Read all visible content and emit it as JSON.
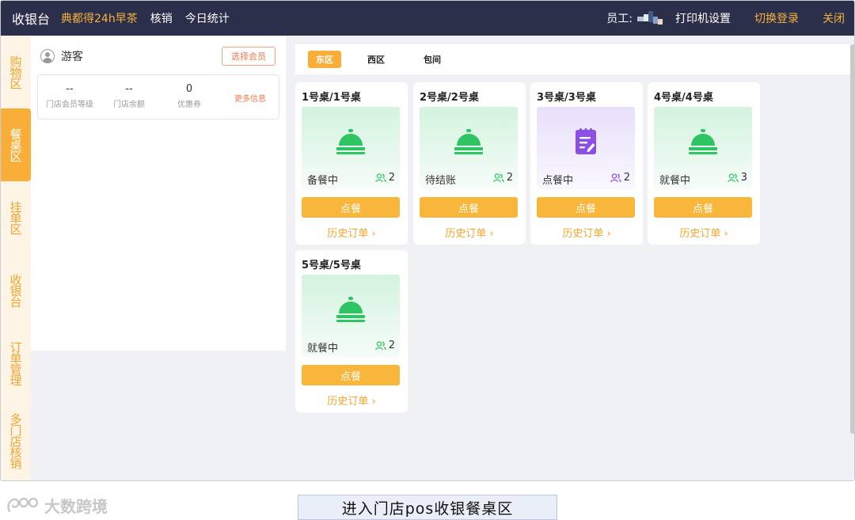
{
  "topbar": {
    "brand": "收银台",
    "store_name": "典都得24h早茶",
    "nav": [
      "核销",
      "今日统计"
    ],
    "staff_label": "员工:",
    "printer_settings": "打印机设置",
    "switch_login": "切换登录",
    "close": "关闭",
    "accent_color": "#f7b23b",
    "background_color": "#2b2f4a"
  },
  "sidebar": {
    "items": [
      {
        "label": "购物区",
        "active": false
      },
      {
        "label": "餐桌区",
        "active": true
      },
      {
        "label": "挂单区",
        "active": false
      },
      {
        "label": "收银台",
        "active": false
      },
      {
        "label": "订单管理",
        "active": false
      },
      {
        "label": "多门店核销",
        "active": false
      }
    ]
  },
  "member": {
    "guest_label": "游客",
    "choose_member": "选择会员",
    "stats": [
      {
        "value": "--",
        "label": "门店会员等级"
      },
      {
        "value": "--",
        "label": "门店余额"
      },
      {
        "value": "0",
        "label": "优惠券"
      }
    ],
    "more_info": "更多信息"
  },
  "areas": {
    "tabs": [
      {
        "label": "东区",
        "active": true
      },
      {
        "label": "西区",
        "active": false
      },
      {
        "label": "包间",
        "active": false
      }
    ]
  },
  "tables": [
    {
      "title": "1号桌/1号桌",
      "status": "备餐中",
      "people": "2",
      "icon": "food-cover-icon",
      "color": "#2fc463",
      "order_label": "点餐",
      "history_label": "历史订单 ›"
    },
    {
      "title": "2号桌/2号桌",
      "status": "待结账",
      "people": "2",
      "icon": "food-cover-icon",
      "color": "#2fc463",
      "order_label": "点餐",
      "history_label": "历史订单 ›"
    },
    {
      "title": "3号桌/3号桌",
      "status": "点餐中",
      "people": "2",
      "icon": "order-note-icon",
      "color": "#8b4fe6",
      "order_label": "点餐",
      "history_label": "历史订单 ›"
    },
    {
      "title": "4号桌/4号桌",
      "status": "就餐中",
      "people": "3",
      "icon": "food-cover-icon",
      "color": "#2fc463",
      "order_label": "点餐",
      "history_label": "历史订单 ›"
    },
    {
      "title": "5号桌/5号桌",
      "status": "就餐中",
      "people": "2",
      "icon": "food-cover-icon",
      "color": "#2fc463",
      "order_label": "点餐",
      "history_label": "历史订单 ›"
    }
  ],
  "caption": "进入门店pos收银餐桌区",
  "watermark": "大数跨境"
}
